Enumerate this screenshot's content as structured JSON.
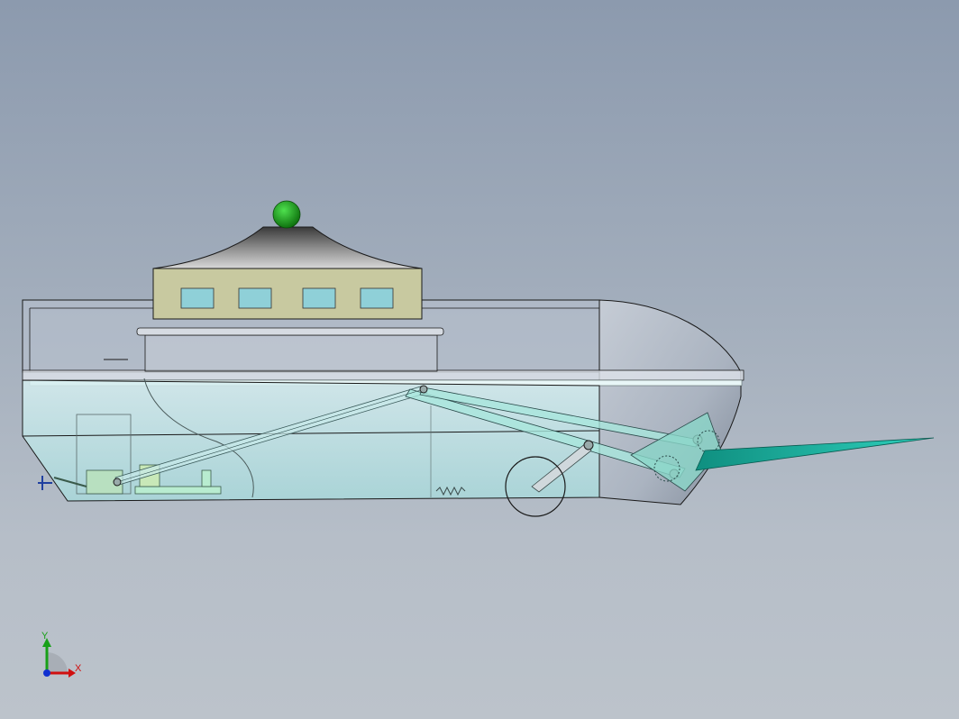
{
  "view": {
    "background_top": "#8c9aae",
    "background_bottom": "#bcc3cb",
    "model_outline": "#1a1a1a",
    "glass_color": "#bfe8ea",
    "deck_house_color": "#c8c9a0",
    "window_color": "#8fd0d8",
    "dome_color": "#6b6b6b",
    "beacon_color": "#18a018",
    "blade_color": "#1ab5a0"
  },
  "triad": {
    "x_label": "X",
    "y_label": "Y",
    "x_color": "#d01010",
    "y_color": "#18a018",
    "z_color": "#1030d0"
  }
}
